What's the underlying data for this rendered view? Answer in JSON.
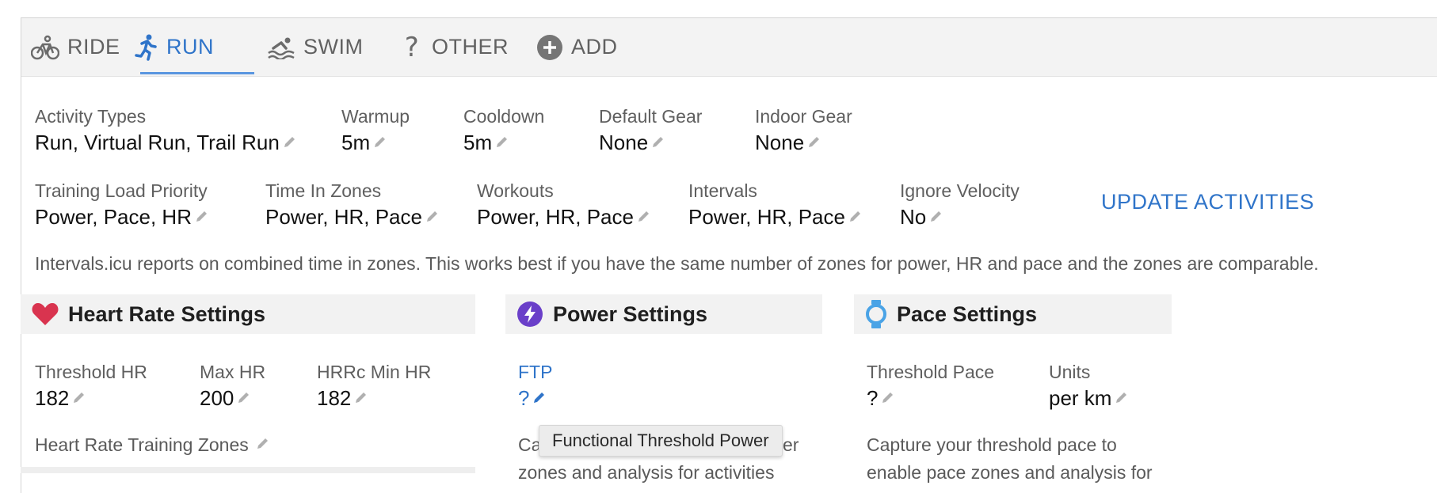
{
  "tabs": [
    {
      "label": "RIDE",
      "icon": "bicycle-icon"
    },
    {
      "label": "RUN",
      "icon": "runner-icon",
      "active": true
    },
    {
      "label": "SWIM",
      "icon": "swimmer-icon"
    },
    {
      "label": "OTHER",
      "icon": "question-icon"
    },
    {
      "label": "ADD",
      "icon": "plus-circle-icon"
    }
  ],
  "settings": {
    "activity_types": {
      "label": "Activity Types",
      "value": "Run, Virtual Run, Trail Run"
    },
    "warmup": {
      "label": "Warmup",
      "value": "5m"
    },
    "cooldown": {
      "label": "Cooldown",
      "value": "5m"
    },
    "default_gear": {
      "label": "Default Gear",
      "value": "None"
    },
    "indoor_gear": {
      "label": "Indoor Gear",
      "value": "None"
    },
    "training_load_priority": {
      "label": "Training Load Priority",
      "value": "Power, Pace, HR"
    },
    "time_in_zones": {
      "label": "Time In Zones",
      "value": "Power, HR, Pace"
    },
    "workouts": {
      "label": "Workouts",
      "value": "Power, HR, Pace"
    },
    "intervals": {
      "label": "Intervals",
      "value": "Power, HR, Pace"
    },
    "ignore_velocity": {
      "label": "Ignore Velocity",
      "value": "No"
    }
  },
  "update_button": "UPDATE ACTIVITIES",
  "note": "Intervals.icu reports on combined time in zones. This works best if you have the same number of zones for power, HR and pace and the zones are comparable.",
  "hr_section": {
    "title": "Heart Rate Settings",
    "threshold_hr": {
      "label": "Threshold HR",
      "value": "182"
    },
    "max_hr": {
      "label": "Max HR",
      "value": "200"
    },
    "hrrc_min_hr": {
      "label": "HRRc Min HR",
      "value": "182"
    },
    "zones_label": "Heart Rate Training Zones"
  },
  "power_section": {
    "title": "Power Settings",
    "ftp": {
      "label": "FTP",
      "value": "?"
    },
    "text_start": "Ca",
    "text_end": "er",
    "text_line2": "zones and analysis for activities"
  },
  "pace_section": {
    "title": "Pace Settings",
    "threshold_pace": {
      "label": "Threshold Pace",
      "value": "?"
    },
    "units": {
      "label": "Units",
      "value": "per km"
    },
    "text_line1": "Capture your threshold pace to",
    "text_line2": "enable pace zones and analysis for"
  },
  "tooltip": "Functional Threshold Power",
  "colors": {
    "accent": "#2f74c9",
    "heart": "#d9344f",
    "power": "#6a3fc9",
    "pace": "#4aa3e6"
  }
}
